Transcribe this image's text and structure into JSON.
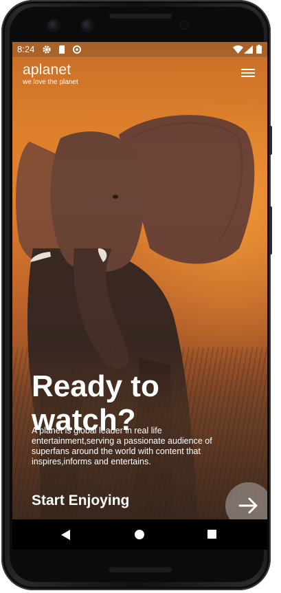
{
  "status_bar": {
    "time": "8:24",
    "icons": [
      "gear-icon",
      "sd-card-icon",
      "sync-icon",
      "wifi-icon",
      "signal-icon",
      "battery-icon"
    ]
  },
  "header": {
    "brand_name": "aplanet",
    "tagline": "we love the planet",
    "menu_icon": "hamburger-menu-icon"
  },
  "hero": {
    "headline": "Ready to watch?",
    "description": "A planet is global leader in real life entertainment,serving a passionate audience of superfans around the world with content that inspires,informs and entertains.",
    "cta_label": "Start Enjoying",
    "next_icon": "arrow-right-icon",
    "colors": {
      "sky": "#e4832d",
      "status_bar": "#a86228",
      "cta_circle": "#8c827d"
    }
  },
  "nav_bar": {
    "items": [
      "back-icon",
      "home-icon",
      "recent-apps-icon"
    ]
  }
}
